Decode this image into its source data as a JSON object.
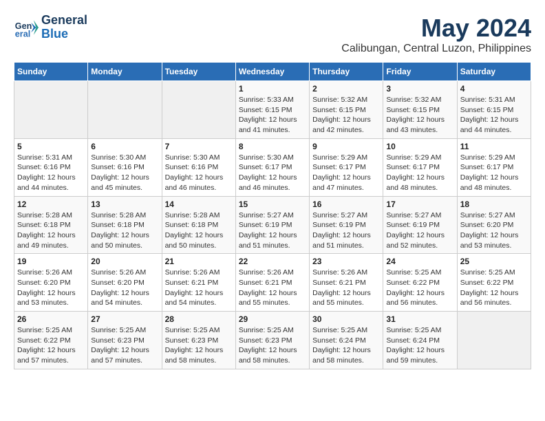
{
  "logo": {
    "line1": "General",
    "line2": "Blue"
  },
  "title": "May 2024",
  "subtitle": "Calibungan, Central Luzon, Philippines",
  "headers": [
    "Sunday",
    "Monday",
    "Tuesday",
    "Wednesday",
    "Thursday",
    "Friday",
    "Saturday"
  ],
  "weeks": [
    [
      {
        "day": "",
        "info": ""
      },
      {
        "day": "",
        "info": ""
      },
      {
        "day": "",
        "info": ""
      },
      {
        "day": "1",
        "info": "Sunrise: 5:33 AM\nSunset: 6:15 PM\nDaylight: 12 hours\nand 41 minutes."
      },
      {
        "day": "2",
        "info": "Sunrise: 5:32 AM\nSunset: 6:15 PM\nDaylight: 12 hours\nand 42 minutes."
      },
      {
        "day": "3",
        "info": "Sunrise: 5:32 AM\nSunset: 6:15 PM\nDaylight: 12 hours\nand 43 minutes."
      },
      {
        "day": "4",
        "info": "Sunrise: 5:31 AM\nSunset: 6:15 PM\nDaylight: 12 hours\nand 44 minutes."
      }
    ],
    [
      {
        "day": "5",
        "info": "Sunrise: 5:31 AM\nSunset: 6:16 PM\nDaylight: 12 hours\nand 44 minutes."
      },
      {
        "day": "6",
        "info": "Sunrise: 5:30 AM\nSunset: 6:16 PM\nDaylight: 12 hours\nand 45 minutes."
      },
      {
        "day": "7",
        "info": "Sunrise: 5:30 AM\nSunset: 6:16 PM\nDaylight: 12 hours\nand 46 minutes."
      },
      {
        "day": "8",
        "info": "Sunrise: 5:30 AM\nSunset: 6:17 PM\nDaylight: 12 hours\nand 46 minutes."
      },
      {
        "day": "9",
        "info": "Sunrise: 5:29 AM\nSunset: 6:17 PM\nDaylight: 12 hours\nand 47 minutes."
      },
      {
        "day": "10",
        "info": "Sunrise: 5:29 AM\nSunset: 6:17 PM\nDaylight: 12 hours\nand 48 minutes."
      },
      {
        "day": "11",
        "info": "Sunrise: 5:29 AM\nSunset: 6:17 PM\nDaylight: 12 hours\nand 48 minutes."
      }
    ],
    [
      {
        "day": "12",
        "info": "Sunrise: 5:28 AM\nSunset: 6:18 PM\nDaylight: 12 hours\nand 49 minutes."
      },
      {
        "day": "13",
        "info": "Sunrise: 5:28 AM\nSunset: 6:18 PM\nDaylight: 12 hours\nand 50 minutes."
      },
      {
        "day": "14",
        "info": "Sunrise: 5:28 AM\nSunset: 6:18 PM\nDaylight: 12 hours\nand 50 minutes."
      },
      {
        "day": "15",
        "info": "Sunrise: 5:27 AM\nSunset: 6:19 PM\nDaylight: 12 hours\nand 51 minutes."
      },
      {
        "day": "16",
        "info": "Sunrise: 5:27 AM\nSunset: 6:19 PM\nDaylight: 12 hours\nand 51 minutes."
      },
      {
        "day": "17",
        "info": "Sunrise: 5:27 AM\nSunset: 6:19 PM\nDaylight: 12 hours\nand 52 minutes."
      },
      {
        "day": "18",
        "info": "Sunrise: 5:27 AM\nSunset: 6:20 PM\nDaylight: 12 hours\nand 53 minutes."
      }
    ],
    [
      {
        "day": "19",
        "info": "Sunrise: 5:26 AM\nSunset: 6:20 PM\nDaylight: 12 hours\nand 53 minutes."
      },
      {
        "day": "20",
        "info": "Sunrise: 5:26 AM\nSunset: 6:20 PM\nDaylight: 12 hours\nand 54 minutes."
      },
      {
        "day": "21",
        "info": "Sunrise: 5:26 AM\nSunset: 6:21 PM\nDaylight: 12 hours\nand 54 minutes."
      },
      {
        "day": "22",
        "info": "Sunrise: 5:26 AM\nSunset: 6:21 PM\nDaylight: 12 hours\nand 55 minutes."
      },
      {
        "day": "23",
        "info": "Sunrise: 5:26 AM\nSunset: 6:21 PM\nDaylight: 12 hours\nand 55 minutes."
      },
      {
        "day": "24",
        "info": "Sunrise: 5:25 AM\nSunset: 6:22 PM\nDaylight: 12 hours\nand 56 minutes."
      },
      {
        "day": "25",
        "info": "Sunrise: 5:25 AM\nSunset: 6:22 PM\nDaylight: 12 hours\nand 56 minutes."
      }
    ],
    [
      {
        "day": "26",
        "info": "Sunrise: 5:25 AM\nSunset: 6:22 PM\nDaylight: 12 hours\nand 57 minutes."
      },
      {
        "day": "27",
        "info": "Sunrise: 5:25 AM\nSunset: 6:23 PM\nDaylight: 12 hours\nand 57 minutes."
      },
      {
        "day": "28",
        "info": "Sunrise: 5:25 AM\nSunset: 6:23 PM\nDaylight: 12 hours\nand 58 minutes."
      },
      {
        "day": "29",
        "info": "Sunrise: 5:25 AM\nSunset: 6:23 PM\nDaylight: 12 hours\nand 58 minutes."
      },
      {
        "day": "30",
        "info": "Sunrise: 5:25 AM\nSunset: 6:24 PM\nDaylight: 12 hours\nand 58 minutes."
      },
      {
        "day": "31",
        "info": "Sunrise: 5:25 AM\nSunset: 6:24 PM\nDaylight: 12 hours\nand 59 minutes."
      },
      {
        "day": "",
        "info": ""
      }
    ]
  ]
}
